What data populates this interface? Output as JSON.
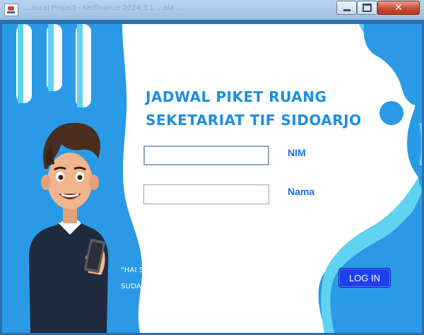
{
  "window": {
    "title": "…ascal Project - Kerfinance 2024.3.1 …ala …",
    "controls": {
      "minimize": "minimize",
      "maximize": "maximize",
      "close": "close"
    }
  },
  "login": {
    "heading_line1": "JADWAL PIKET RUANG",
    "heading_line2": "SEKETARIAT TIF SIDOARJO",
    "nim_label": "NIM",
    "nim_value": "",
    "nama_label": "Nama",
    "nama_value": "",
    "greeting_line1": "\"HAI SELAMAT DATANG, APAKAH KALIAN",
    "greeting_line2": "SUDAH SIAP MELAKSANAKAN PIKET HARI INI\"",
    "login_button": "LOG IN"
  },
  "colors": {
    "accent_blue": "#2a9ae6",
    "heading_blue": "#1d8ee0",
    "label_blue": "#1a73e0",
    "button_blue": "#1e40ee",
    "light_cyan": "#5fd3f0"
  },
  "icons": {
    "app": "java-cup-icon",
    "minimize": "minimize-icon",
    "maximize": "maximize-icon",
    "close": "close-icon"
  }
}
